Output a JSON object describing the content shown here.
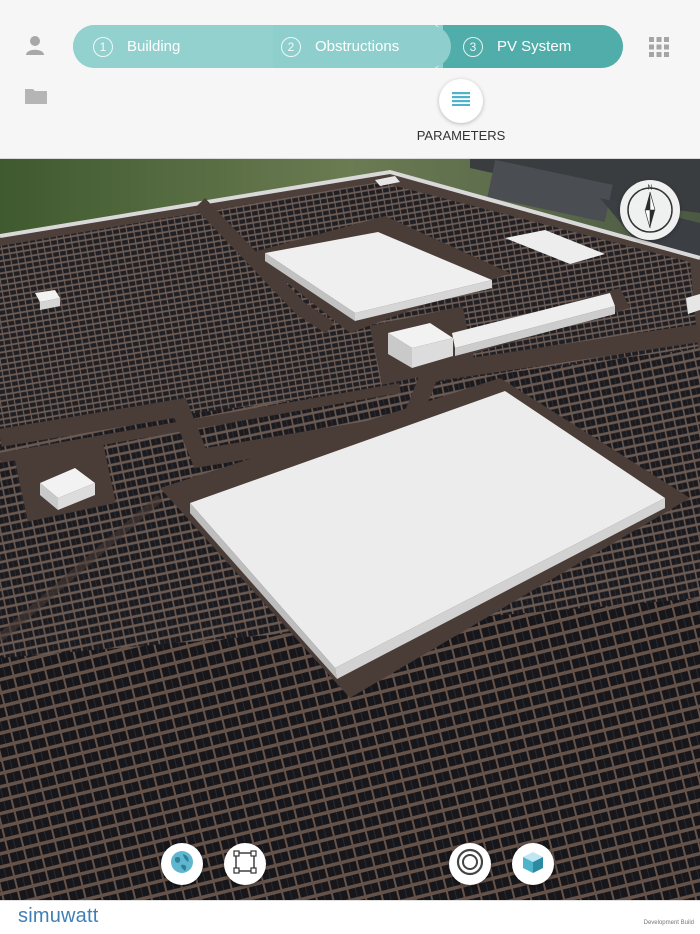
{
  "header": {
    "steps": [
      {
        "number": "1",
        "label": "Building"
      },
      {
        "number": "2",
        "label": "Obstructions"
      },
      {
        "number": "3",
        "label": "PV System"
      }
    ],
    "active_step": 3,
    "parameters_label": "PARAMETERS",
    "icons": {
      "user": "user-icon",
      "folder": "folder-icon",
      "grid": "grid-menu-icon",
      "parameters": "list-icon"
    }
  },
  "map": {
    "compass_letter": "N",
    "tools": [
      "globe-icon",
      "draw-polygon-icon",
      "ring-icon",
      "cube-icon"
    ]
  },
  "footer": {
    "brand": "simuwatt",
    "build_tag": "Development Build"
  },
  "colors": {
    "accent": "#50ada9",
    "step_inactive": "#8fcfcd",
    "roof": "#5a4c47",
    "brand": "#3f7fb6"
  }
}
